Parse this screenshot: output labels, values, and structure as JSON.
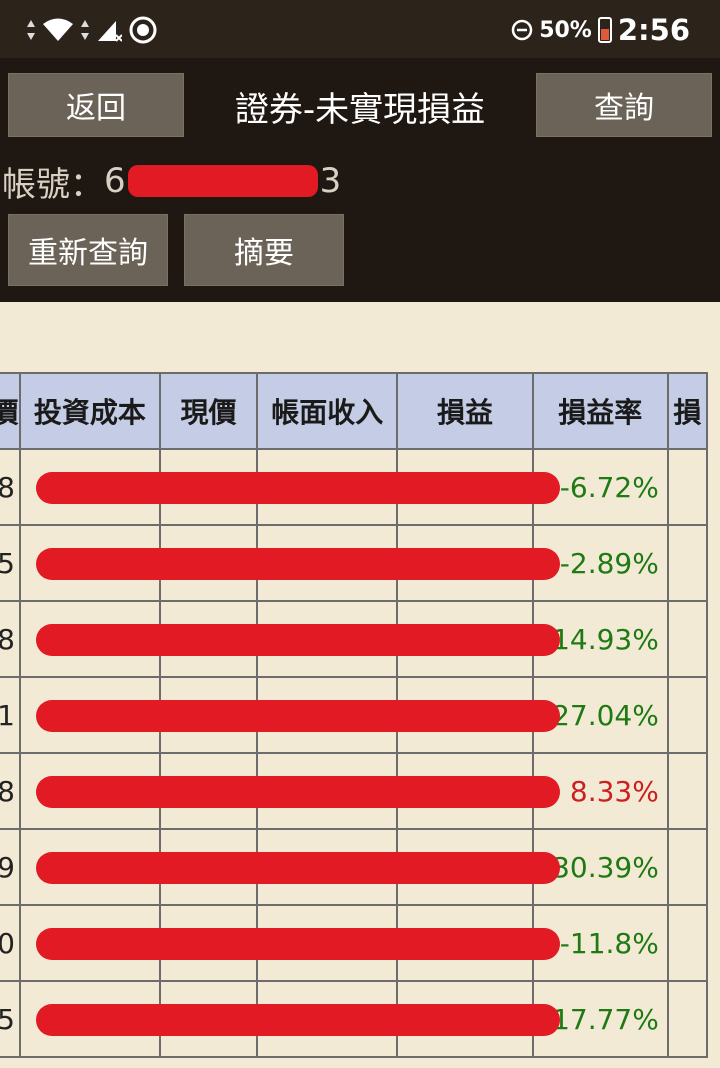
{
  "status_bar": {
    "battery_percent": "50%",
    "time": "2:56"
  },
  "header": {
    "back_label": "返回",
    "title": "證券-未實現損益",
    "query_label": "查詢",
    "account_label": "帳號：",
    "account_prefix": "6",
    "account_suffix": "3",
    "requery_label": "重新查詢",
    "summary_label": "摘要"
  },
  "table": {
    "columns": [
      "價",
      "投資成本",
      "現價",
      "帳面收入",
      "損益",
      "損益率",
      "損"
    ],
    "rows": [
      {
        "lead": "8",
        "rate": "-6.72%",
        "sign": "neg"
      },
      {
        "lead": "5",
        "rate": "-2.89%",
        "sign": "neg"
      },
      {
        "lead": "8",
        "rate": "-14.93%",
        "sign": "neg"
      },
      {
        "lead": "1",
        "rate": "-27.04%",
        "sign": "neg"
      },
      {
        "lead": "8",
        "rate": "8.33%",
        "sign": "pos"
      },
      {
        "lead": "9",
        "rate": "-30.39%",
        "sign": "neg"
      },
      {
        "lead": "0",
        "rate": "-11.8%",
        "sign": "neg"
      },
      {
        "lead": "5",
        "rate": "-17.77%",
        "sign": "neg"
      }
    ]
  },
  "colors": {
    "header_bg": "#1f1712",
    "table_header_bg": "#c5cde6",
    "loss_green": "#1f7a14",
    "gain_red": "#cc1f1f",
    "redaction_red": "#e11a23"
  }
}
